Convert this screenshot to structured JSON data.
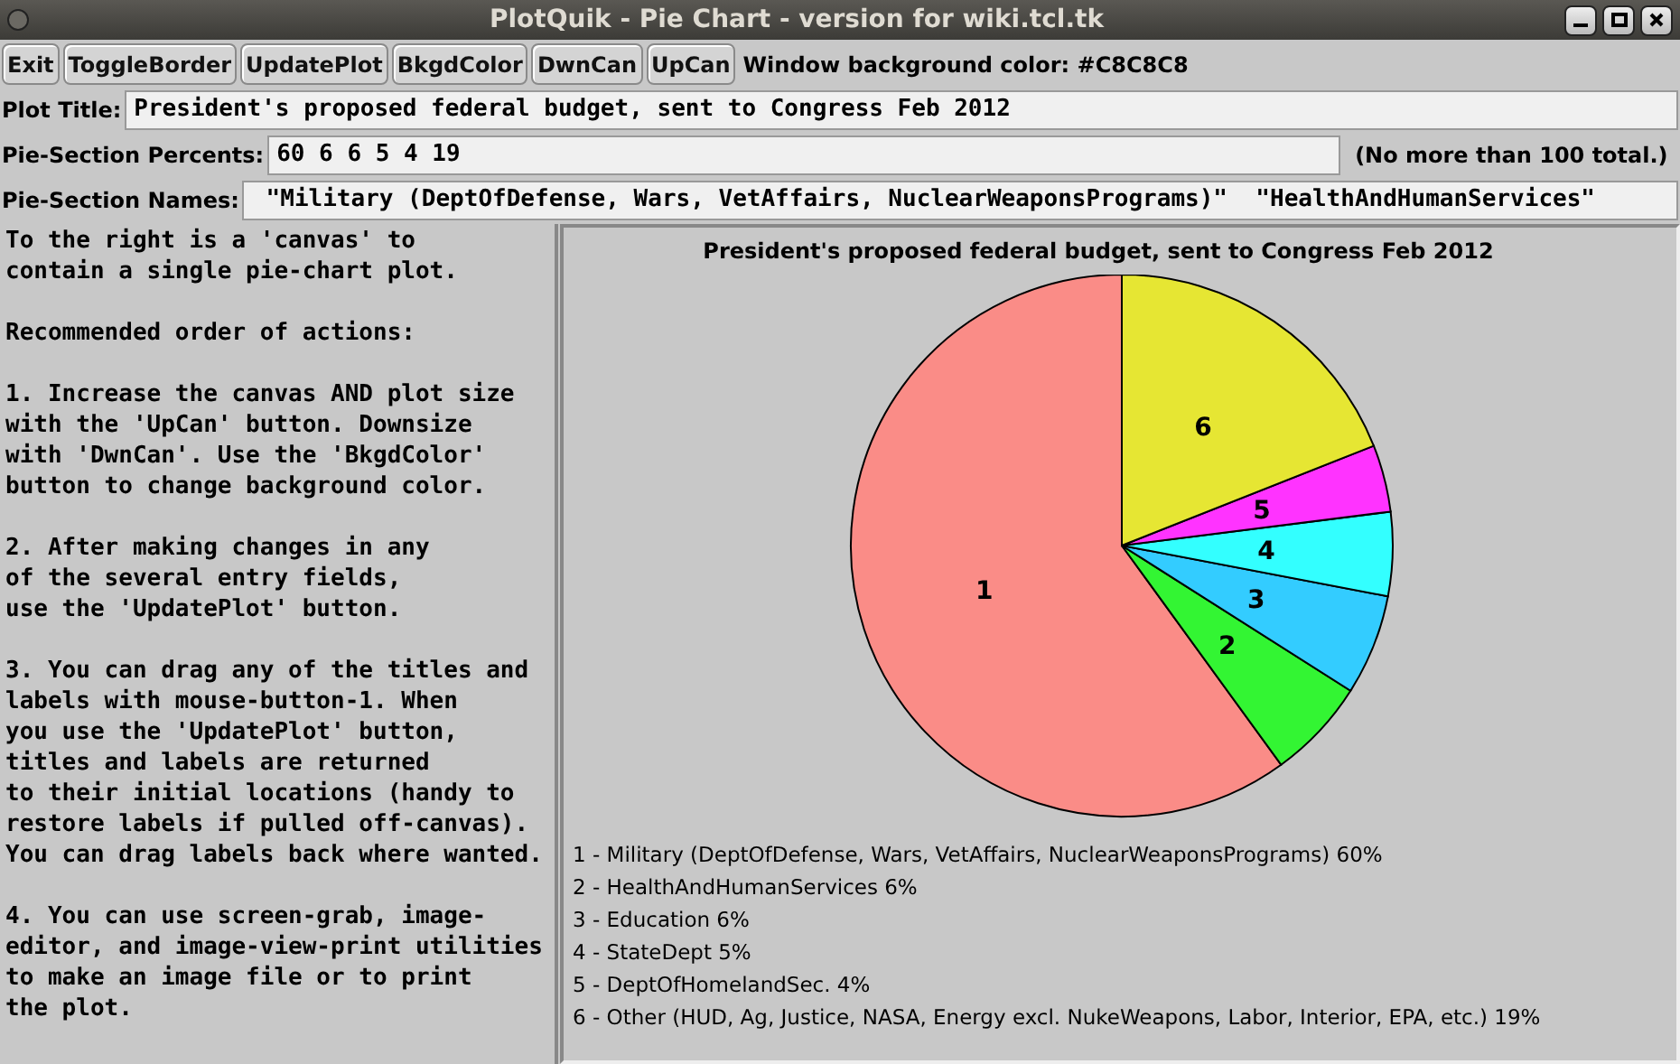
{
  "window": {
    "title": "PlotQuik - Pie Chart - version for wiki.tcl.tk"
  },
  "toolbar": {
    "buttons": [
      "Exit",
      "ToggleBorder",
      "UpdatePlot",
      "BkgdColor",
      "DwnCan",
      "UpCan"
    ],
    "color_label": "Window background color: #C8C8C8"
  },
  "fields": [
    {
      "label": "Plot Title:",
      "value": "President's proposed federal budget, sent to Congress Feb 2012"
    },
    {
      "label": "Pie-Section Percents:",
      "value": "60 6 6 5 4 19",
      "note": "(No more than 100 total.)"
    },
    {
      "label": "Pie-Section Names:",
      "value": " \"Military (DeptOfDefense, Wars, VetAffairs, NuclearWeaponsPrograms)\"  \"HealthAndHumanServices\""
    }
  ],
  "help_text": [
    "To the right is a 'canvas' to\ncontain a single pie-chart plot.",
    "Recommended order of actions:",
    "1. Increase the canvas AND plot size\nwith the 'UpCan' button. Downsize\nwith 'DwnCan'. Use the 'BkgdColor'\nbutton to change background color.",
    "2. After making changes in any\nof the several entry fields,\nuse the 'UpdatePlot' button.",
    "3. You can drag any of the titles and\nlabels with mouse-button-1. When\nyou use the 'UpdatePlot' button,\ntitles and labels are returned\nto their initial locations (handy to\nrestore labels if pulled off-canvas).\nYou can drag labels back where wanted.",
    "4. You can use screen-grab, image-\neditor, and image-view-print utilities\nto make an image file or to print\nthe plot."
  ],
  "canvas": {
    "chart_data": {
      "type": "pie",
      "title": "President's proposed federal budget, sent to Congress Feb 2012",
      "categories": [
        "1",
        "2",
        "3",
        "4",
        "5",
        "6"
      ],
      "series": [
        {
          "values": [
            60,
            6,
            6,
            5,
            4,
            19
          ],
          "colors": [
            "#fa8c87",
            "#33f533",
            "#33ccff",
            "#33ffff",
            "#ff33ff",
            "#e6e633"
          ]
        }
      ]
    },
    "legend": [
      "1 - Military (DeptOfDefense, Wars, VetAffairs, NuclearWeaponsPrograms) 60%",
      "2 - HealthAndHumanServices 6%",
      "3 - Education 6%",
      "4 - StateDept 5%",
      "5 - DeptOfHomelandSec. 4%",
      "6 - Other (HUD, Ag, Justice, NASA, Energy excl. NukeWeapons, Labor, Interior, EPA, etc.) 19%"
    ]
  }
}
